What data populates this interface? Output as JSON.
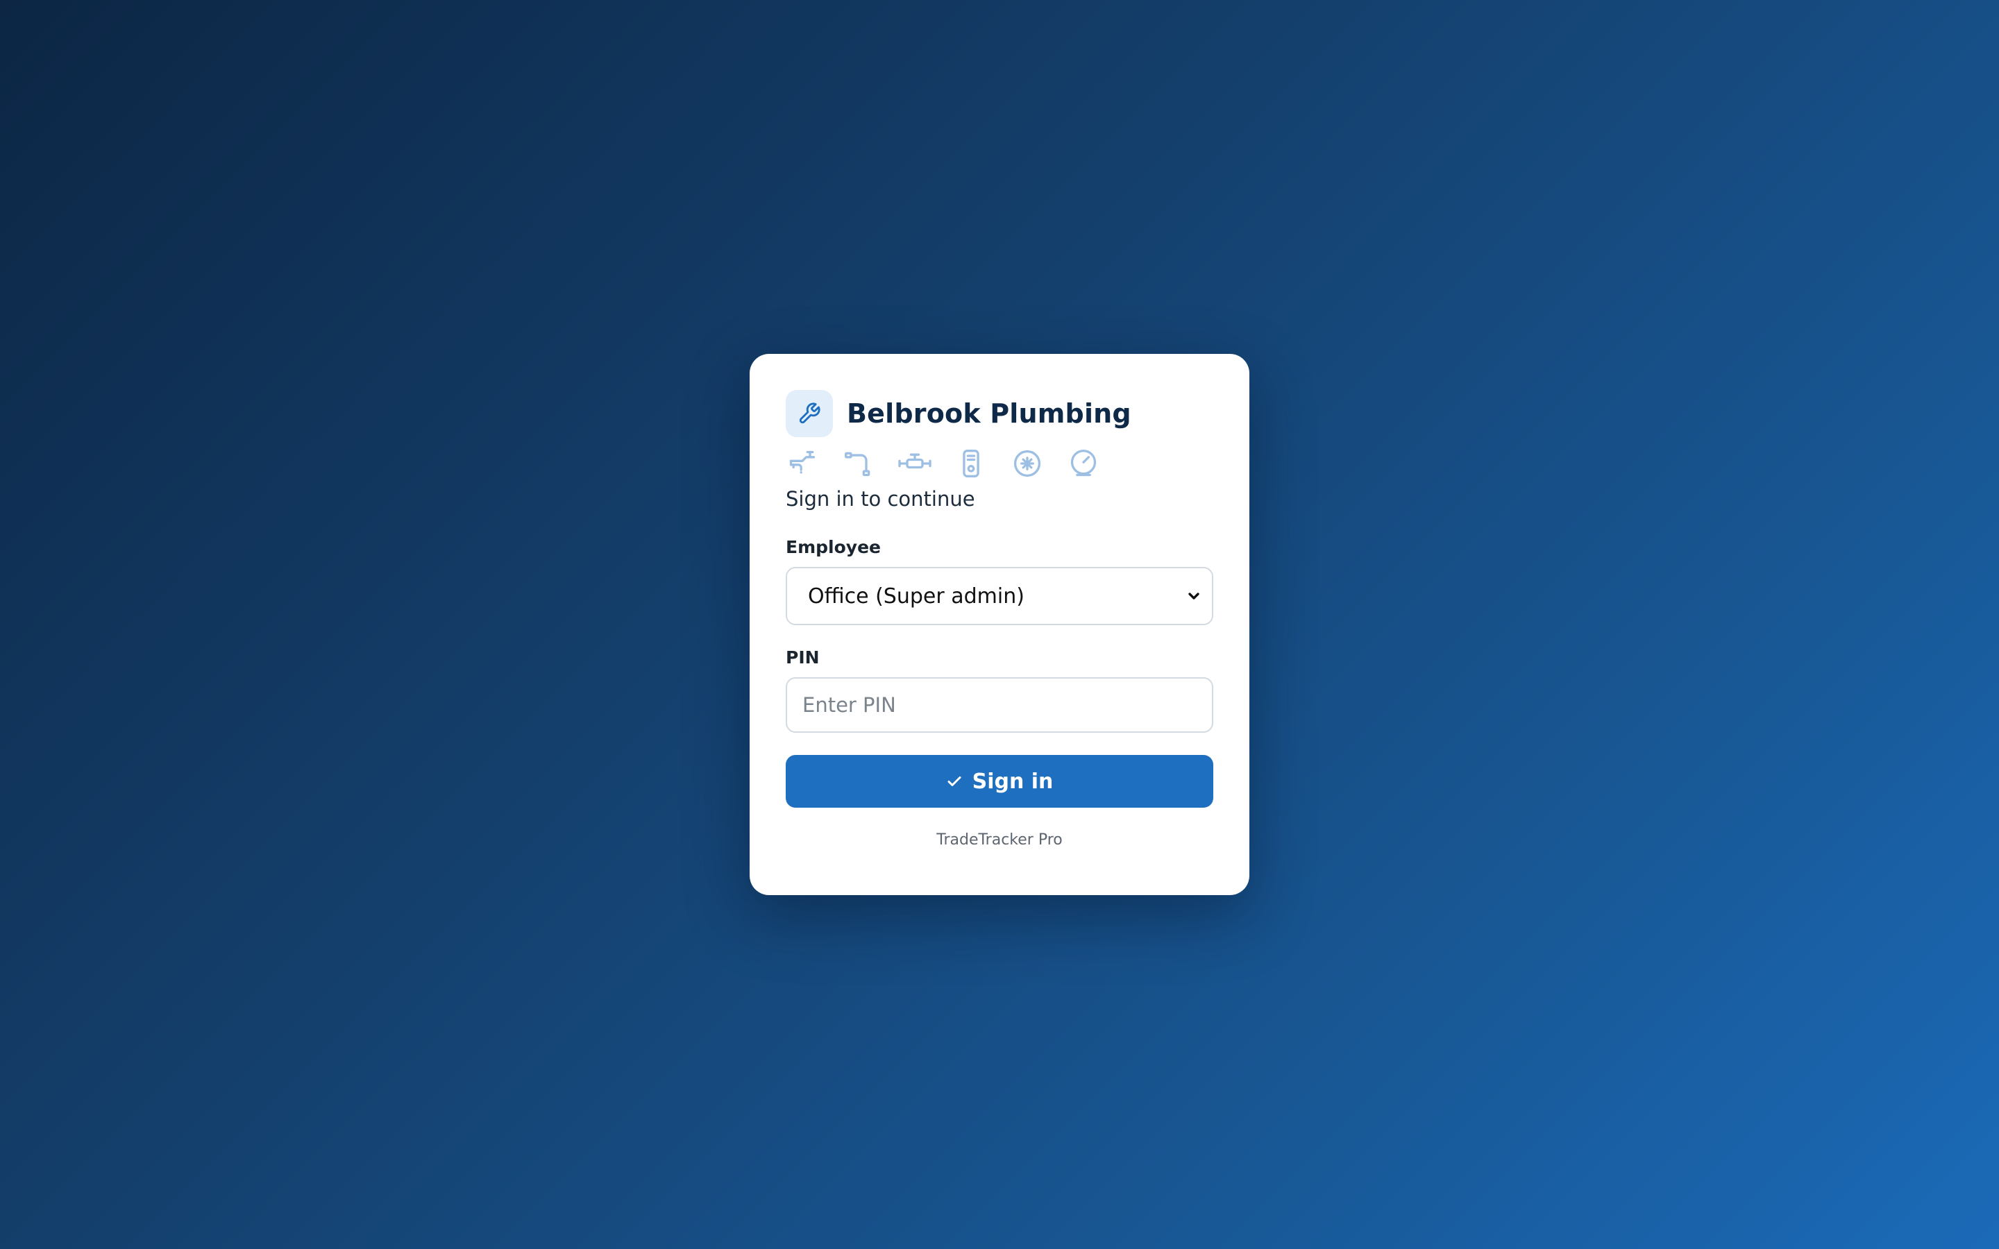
{
  "brand": {
    "icon": "wrench-icon",
    "title": "Belbrook Plumbing"
  },
  "trade_icons": [
    "faucet-icon",
    "pipe-elbow-icon",
    "pipe-valve-icon",
    "water-heater-icon",
    "drain-icon",
    "pressure-gauge-icon"
  ],
  "subtitle": "Sign in to continue",
  "employee": {
    "label": "Employee",
    "selected": "Office (Super admin)"
  },
  "pin": {
    "label": "PIN",
    "value": "",
    "placeholder": "Enter PIN"
  },
  "signin": {
    "icon": "check-icon",
    "label": "Sign in"
  },
  "footer": "TradeTracker Pro",
  "colors": {
    "primary": "#1e6fbf",
    "icon_muted": "#9dbfe3",
    "brand_badge_bg": "#e3eefb",
    "title_text": "#0f2a48"
  }
}
